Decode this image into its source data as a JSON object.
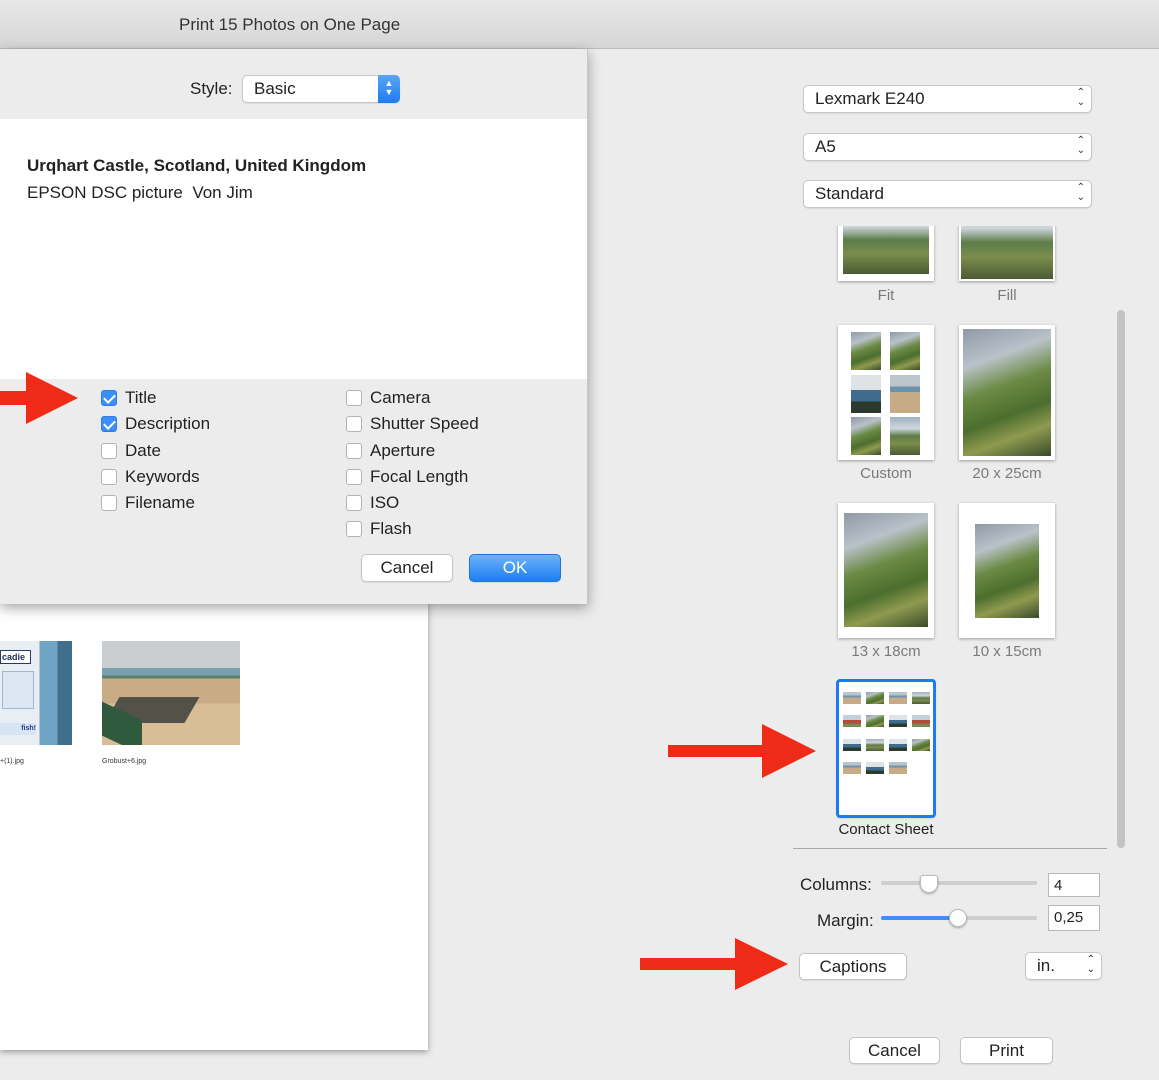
{
  "window": {
    "title": "Print 15 Photos on One Page"
  },
  "captions_sheet": {
    "style_label": "Style:",
    "style_value": "Basic",
    "preview": {
      "title": "Urqhart Castle, Scotland, United Kingdom",
      "description": "EPSON DSC picture  Von Jim"
    },
    "left_options": [
      {
        "label": "Title",
        "checked": true
      },
      {
        "label": "Description",
        "checked": true
      },
      {
        "label": "Date",
        "checked": false
      },
      {
        "label": "Keywords",
        "checked": false
      },
      {
        "label": "Filename",
        "checked": false
      }
    ],
    "right_options": [
      {
        "label": "Camera",
        "checked": false
      },
      {
        "label": "Shutter Speed",
        "checked": false
      },
      {
        "label": "Aperture",
        "checked": false
      },
      {
        "label": "Focal Length",
        "checked": false
      },
      {
        "label": "ISO",
        "checked": false
      },
      {
        "label": "Flash",
        "checked": false
      }
    ],
    "cancel_label": "Cancel",
    "ok_label": "OK"
  },
  "page_preview": {
    "left_thumb_label": "cadie",
    "left_thumb_sub": "fish!",
    "left_caption": "+(1).jpg",
    "right_caption": "Grobust+6.jpg"
  },
  "printer": {
    "printer": "Lexmark E240",
    "paper_size": "A5",
    "quality": "Standard"
  },
  "layouts": [
    {
      "label": "Fit"
    },
    {
      "label": "Fill"
    },
    {
      "label": "Custom"
    },
    {
      "label": "20 x 25cm"
    },
    {
      "label": "13 x 18cm"
    },
    {
      "label": "10 x 15cm"
    },
    {
      "label": "Contact Sheet",
      "selected": true
    }
  ],
  "settings": {
    "columns_label": "Columns:",
    "columns_value": "4",
    "margin_label": "Margin:",
    "margin_value": "0,25",
    "margin_fill_fraction": 0.49,
    "captions_label": "Captions",
    "units": "in."
  },
  "footer": {
    "cancel_label": "Cancel",
    "print_label": "Print"
  },
  "colors": {
    "accent": "#1c7cf0",
    "annotation_arrow": "#ee2b16"
  }
}
